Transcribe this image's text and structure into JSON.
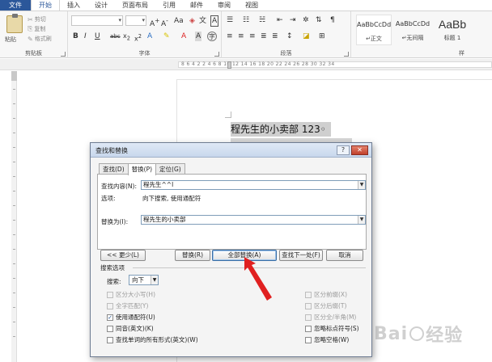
{
  "ribbon": {
    "tabs": [
      "文件",
      "开始",
      "插入",
      "设计",
      "页面布局",
      "引用",
      "邮件",
      "审阅",
      "视图"
    ],
    "active_tab": "开始",
    "clipboard": {
      "paste": "粘贴",
      "cut": "剪切",
      "copy": "复制",
      "format_painter": "格式刷",
      "group_label": "剪贴板"
    },
    "font_group_label": "字体",
    "paragraph_group_label": "段落",
    "styles_group_label": "样",
    "styles": [
      {
        "sample": "AaBbCcDd",
        "name": "↵正文"
      },
      {
        "sample": "AaBbCcDd",
        "name": "↵无间隔"
      },
      {
        "sample": "AaBb",
        "name": "标题 1"
      }
    ]
  },
  "ruler": {
    "numbers": "8  6  4  2     2  4  6  8  10  12  14  16  18  20  22  24  26  28  30  32  34"
  },
  "document": {
    "line1": "程先生的小卖部 123◦"
  },
  "dialog": {
    "title": "查找和替换",
    "help": "?",
    "close": "✕",
    "tabs": [
      "查找(D)",
      "替换(P)",
      "定位(G)"
    ],
    "active_tab": "替换(P)",
    "find_label": "查找内容(N):",
    "find_value": "程先生^^l",
    "options_label": "选项:",
    "options_value": "向下搜索, 使用通配符",
    "replace_label": "替换为(I):",
    "replace_value": "程先生的小卖部",
    "buttons": {
      "less": "<< 更少(L)",
      "replace": "替换(R)",
      "replace_all": "全部替换(A)",
      "find_next": "查找下一处(F)",
      "cancel": "取消"
    },
    "search_options_title": "搜索选项",
    "search_label": "搜索:",
    "search_value": "向下",
    "left_checks": [
      {
        "label": "区分大小写(H)",
        "checked": false,
        "disabled": true
      },
      {
        "label": "全字匹配(Y)",
        "checked": false,
        "disabled": true
      },
      {
        "label": "使用通配符(U)",
        "checked": true,
        "disabled": false
      },
      {
        "label": "同音(英文)(K)",
        "checked": false,
        "disabled": false
      },
      {
        "label": "查找单词的所有形式(英文)(W)",
        "checked": false,
        "disabled": false
      }
    ],
    "right_checks": [
      {
        "label": "区分前缀(X)",
        "checked": false,
        "disabled": true
      },
      {
        "label": "区分后缀(T)",
        "checked": false,
        "disabled": true
      },
      {
        "label": "区分全/半角(M)",
        "checked": false,
        "disabled": true
      },
      {
        "label": "忽略标点符号(S)",
        "checked": false,
        "disabled": false
      },
      {
        "label": "忽略空格(W)",
        "checked": false,
        "disabled": false
      }
    ],
    "checked_mark": "✓"
  },
  "watermark": {
    "text1": "Bai",
    "text2": "经验"
  },
  "colors": {
    "file_tab": "#2b579a",
    "arrow": "#e02020"
  }
}
